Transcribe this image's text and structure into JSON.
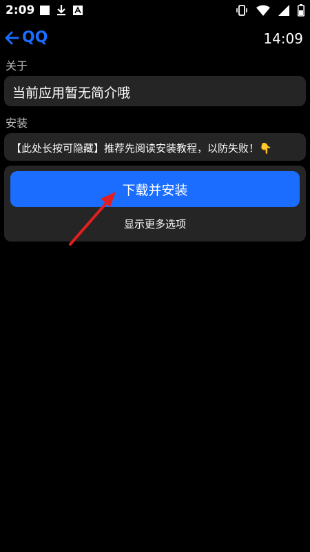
{
  "status_bar": {
    "time": "2:09",
    "icons_left": [
      "square-notification-icon",
      "download-icon",
      "android-a-icon"
    ],
    "icons_right": [
      "vibrate-icon",
      "wifi-icon",
      "signal-icon",
      "battery-icon"
    ]
  },
  "app_bar": {
    "back_label": "QQ",
    "clock": "14:09",
    "accent_color": "#1a6dff"
  },
  "about": {
    "label": "关于",
    "text": "当前应用暂无简介哦"
  },
  "install": {
    "label": "安装",
    "notice": "【此处长按可隐藏】推荐先阅读安装教程，以防失败！👇",
    "button_label": "下载并安装",
    "more_options": "显示更多选项"
  },
  "annotation": {
    "arrow_color": "#e02020",
    "icon": "red-arrow-annotation"
  }
}
